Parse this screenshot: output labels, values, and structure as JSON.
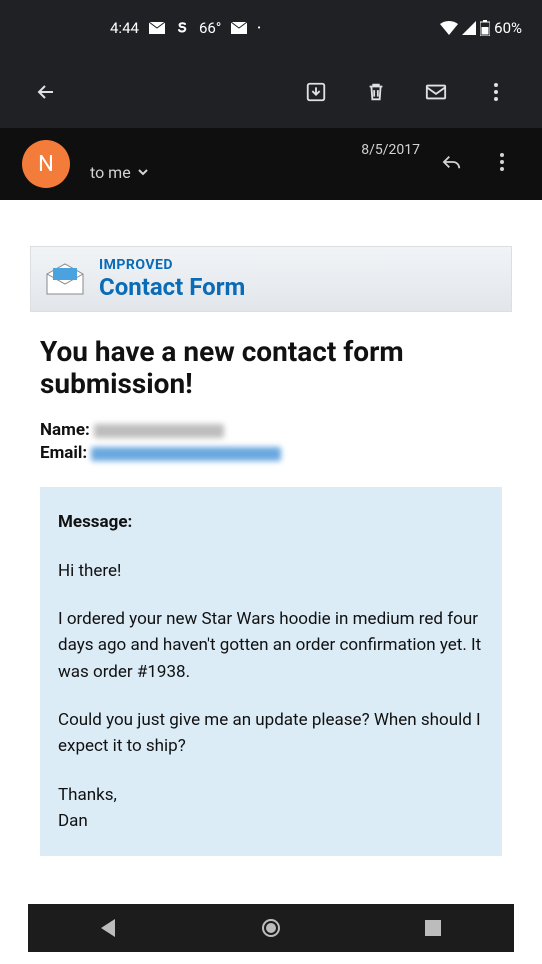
{
  "status": {
    "time": "4:44",
    "temperature": "66°",
    "battery": "60%"
  },
  "email": {
    "date": "8/5/2017",
    "avatar_initial": "N",
    "recipient_label": "to me"
  },
  "banner": {
    "line1": "IMPROVED",
    "line2": "Contact Form"
  },
  "content": {
    "headline": "You have a new contact form submission!",
    "name_label": "Name:",
    "email_label": "Email:",
    "message_label": "Message:",
    "message_body_1": "Hi there!",
    "message_body_2": "I ordered your new Star Wars hoodie in medium red four days ago and haven't gotten an order confirmation yet. It was order #1938.",
    "message_body_3": "Could you just give me an update please? When should I expect it to ship?",
    "message_body_4": "Thanks,\nDan"
  }
}
